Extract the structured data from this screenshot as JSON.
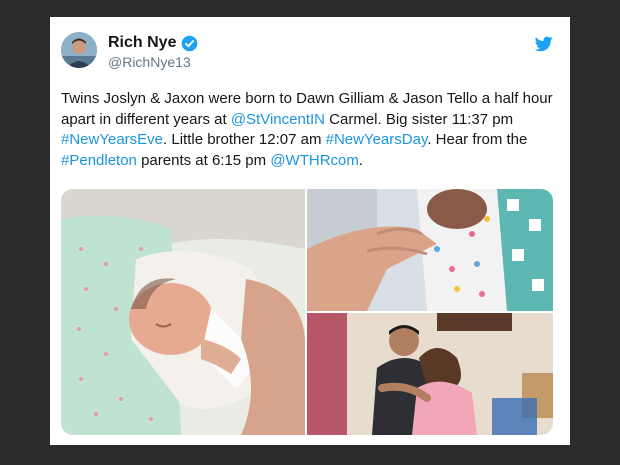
{
  "tweet": {
    "author": {
      "display_name": "Rich Nye",
      "handle": "@RichNye13",
      "verified": true,
      "avatar": "author-avatar"
    },
    "brand_icon": "twitter-bird-icon",
    "text": {
      "segment_1": "Twins Joslyn & Jaxon were born to Dawn Gilliam & Jason Tello a half hour apart in different years at ",
      "mention_1": "@StVincentIN",
      "segment_2": " Carmel. Big sister 11:37 pm ",
      "hashtag_1": "#NewYearsEve",
      "segment_3": ". Little brother 12:07 am ",
      "hashtag_2": "#NewYearsDay",
      "segment_4": ". Hear from the ",
      "hashtag_3": "#Pendleton",
      "segment_5": " parents at 6:15 pm ",
      "mention_2": "@WTHRcom",
      "segment_6": "."
    },
    "media": [
      {
        "name": "newborn-sleeping-photo"
      },
      {
        "name": "newborn-hand-photo"
      },
      {
        "name": "parents-photo"
      }
    ]
  },
  "colors": {
    "page_background": "#2b2b2b",
    "card_background": "#ffffff",
    "text": "#14171a",
    "link": "#1b95e0",
    "handle": "#657786",
    "verified": "#1da1f2"
  }
}
